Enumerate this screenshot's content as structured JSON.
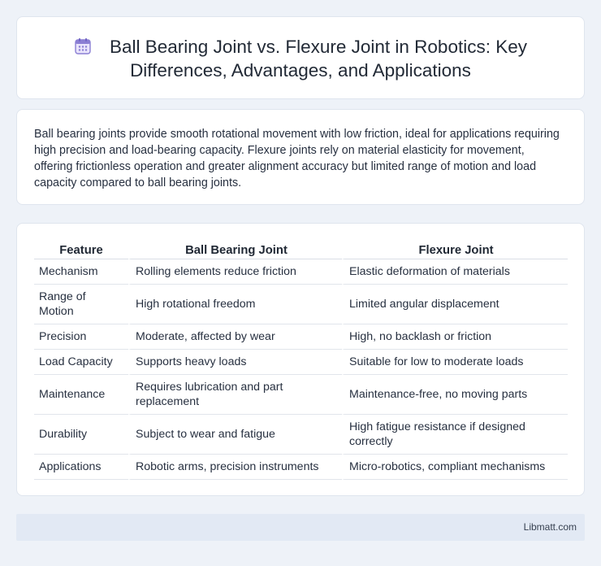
{
  "header": {
    "title": "Ball Bearing Joint vs. Flexure Joint in Robotics: Key Differences, Advantages, and Applications",
    "icon": "calendar-icon",
    "icon_color": "#8b7fd4"
  },
  "summary": {
    "text": "Ball bearing joints provide smooth rotational movement with low friction, ideal for applications requiring high precision and load-bearing capacity. Flexure joints rely on material elasticity for movement, offering frictionless operation and greater alignment accuracy but limited range of motion and load capacity compared to ball bearing joints."
  },
  "table": {
    "headers": [
      "Feature",
      "Ball Bearing Joint",
      "Flexure Joint"
    ],
    "rows": [
      [
        "Mechanism",
        "Rolling elements reduce friction",
        "Elastic deformation of materials"
      ],
      [
        "Range of Motion",
        "High rotational freedom",
        "Limited angular displacement"
      ],
      [
        "Precision",
        "Moderate, affected by wear",
        "High, no backlash or friction"
      ],
      [
        "Load Capacity",
        "Supports heavy loads",
        "Suitable for low to moderate loads"
      ],
      [
        "Maintenance",
        "Requires lubrication and part replacement",
        "Maintenance-free, no moving parts"
      ],
      [
        "Durability",
        "Subject to wear and fatigue",
        "High fatigue resistance if designed correctly"
      ],
      [
        "Applications",
        "Robotic arms, precision instruments",
        "Micro-robotics, compliant mechanisms"
      ]
    ]
  },
  "footer": {
    "brand": "Libmatt.com"
  }
}
